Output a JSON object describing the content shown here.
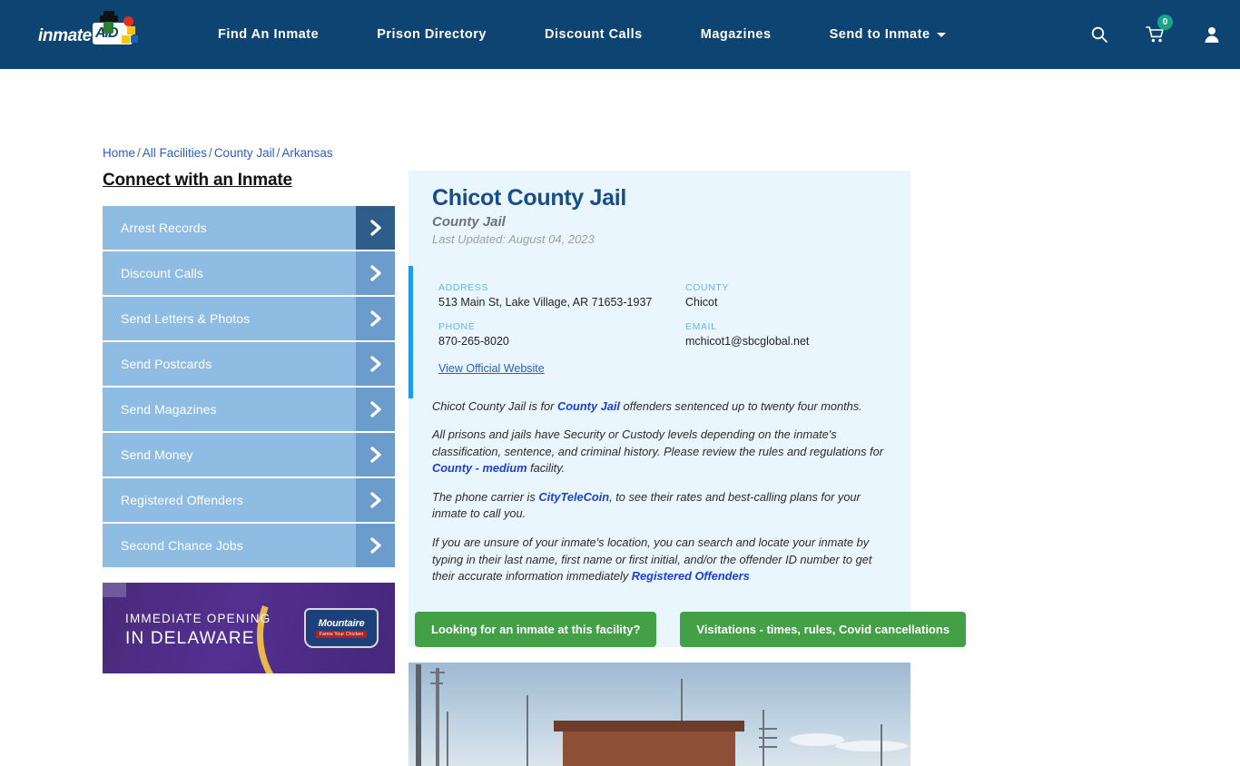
{
  "header": {
    "logo_text": "inmate",
    "logo_badge": "AID",
    "nav": [
      {
        "label": "Find An Inmate",
        "has_caret": false
      },
      {
        "label": "Prison Directory",
        "has_caret": false
      },
      {
        "label": "Discount Calls",
        "has_caret": false
      },
      {
        "label": "Magazines",
        "has_caret": false
      },
      {
        "label": "Send to Inmate",
        "has_caret": true
      }
    ],
    "icons": {
      "search": "search-icon",
      "cart": "cart-icon",
      "cart_count": "0",
      "account": "user-icon"
    },
    "background_color": "#0e4471"
  },
  "breadcrumb": {
    "items": [
      "Home",
      "All Facilities",
      "County Jail",
      "Arkansas"
    ],
    "separator": "/"
  },
  "sidebar": {
    "title": "Connect with an Inmate",
    "items": [
      {
        "label": "Arrest Records"
      },
      {
        "label": "Discount Calls"
      },
      {
        "label": "Send Letters & Photos"
      },
      {
        "label": "Send Postcards"
      },
      {
        "label": "Send Magazines"
      },
      {
        "label": "Send Money"
      },
      {
        "label": "Registered Offenders"
      },
      {
        "label": "Second Chance Jobs"
      }
    ]
  },
  "ad": {
    "line1": "IMMEDIATE OPENING",
    "line2": "IN DELAWARE",
    "brand": "Mountaire",
    "brand_sub": "Farms Your Chicken"
  },
  "facility": {
    "name": "Chicot County Jail",
    "type": "County Jail",
    "last_updated": "Last Updated: August 04, 2023",
    "fields": [
      {
        "label": "ADDRESS",
        "value": "513 Main St, Lake Village, AR 71653-1937"
      },
      {
        "label": "COUNTY",
        "value": "Chicot"
      },
      {
        "label": "PHONE",
        "value": "870-265-8020"
      },
      {
        "label": "EMAIL",
        "value": "mchicot1@sbcglobal.net"
      }
    ],
    "official_website_link": "View Official Website"
  },
  "description": {
    "p1_before": "Chicot County Jail is for ",
    "p1_link": "County Jail",
    "p1_after": " offenders sentenced up to twenty four months.",
    "p2_before": "All prisons and jails have Security or Custody levels depending on the inmate's classification, sentence, and criminal history. Please review the rules and regulations for ",
    "p2_link": "County - medium",
    "p2_after": " facility.",
    "p3_before": "The phone carrier is ",
    "p3_link": "CityTeleCoin",
    "p3_after": ", to see their rates and best-calling plans for your inmate to call you.",
    "p4_before": "If you are unsure of your inmate's location, you can search and locate your inmate by typing in their last name, first name or first initial, and/or the offender ID number to get their accurate information immediately ",
    "p4_link": "Registered Offenders"
  },
  "cta": {
    "primary": "Looking for an inmate at this facility?",
    "secondary": "Visitations - times, rules, Covid cancellations",
    "color": "#43a047"
  },
  "colors": {
    "header_navy": "#0e4471",
    "card_bg": "#eaf6fd",
    "accent_bar": "#1e9bf0",
    "sidebar_btn": "#8fbce3",
    "sidebar_chevron": "#6b9ccc",
    "sidebar_chevron_active": "#2f5d8a",
    "link_blue": "#2b5fc4",
    "title_navy": "#174e87"
  }
}
